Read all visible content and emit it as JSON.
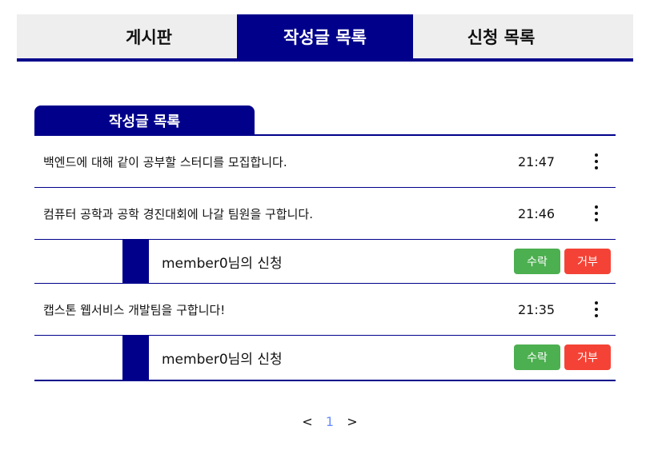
{
  "tabs": [
    {
      "label": "게시판"
    },
    {
      "label": "작성글 목록"
    },
    {
      "label": "신청 목록"
    }
  ],
  "section": {
    "title": "작성글 목록"
  },
  "posts": [
    {
      "title": "백엔드에 대해 같이 공부할 스터디를 모집합니다.",
      "time": "21:47"
    },
    {
      "title": "컴퓨터 공학과 공학 경진대회에 나갈 팀원을 구합니다.",
      "time": "21:46",
      "request": {
        "label": "member0님의 신청",
        "accept": "수락",
        "reject": "거부"
      }
    },
    {
      "title": "캡스톤 웹서비스 개발팀을 구합니다!",
      "time": "21:35",
      "request": {
        "label": "member0님의 신청",
        "accept": "수락",
        "reject": "거부"
      }
    }
  ],
  "pagination": {
    "prev": "<",
    "current": "1",
    "next": ">"
  },
  "colors": {
    "accent": "#00008b",
    "accept": "#4caf50",
    "reject": "#f44336",
    "page_link": "#6b8cff"
  },
  "icons": {
    "more": "more-vertical-icon"
  }
}
